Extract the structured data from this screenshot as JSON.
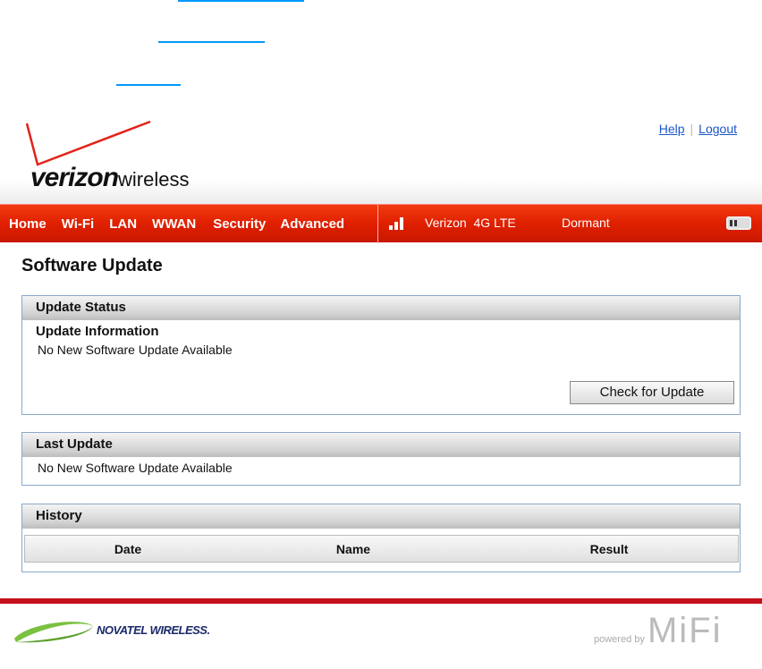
{
  "header": {
    "brand": "verizon",
    "brand_suffix": "wireless",
    "links": {
      "help": "Help",
      "logout": "Logout"
    }
  },
  "nav": {
    "items": [
      "Home",
      "Wi-Fi",
      "LAN",
      "WWAN",
      "Security",
      "Advanced"
    ],
    "carrier": "Verizon",
    "network": "4G LTE",
    "status": "Dormant"
  },
  "page": {
    "title": "Software Update"
  },
  "update_status": {
    "title": "Update Status",
    "subtitle": "Update Information",
    "message": "No New Software Update Available",
    "button": "Check for Update"
  },
  "last_update": {
    "title": "Last Update",
    "message": "No New Software Update Available"
  },
  "history": {
    "title": "History",
    "columns": [
      "Date",
      "Name",
      "Result"
    ]
  },
  "footer": {
    "left_logo": "NOVATEL WIRELESS.",
    "right_logo_prefix": "powered by",
    "right_logo": "MiFi"
  }
}
